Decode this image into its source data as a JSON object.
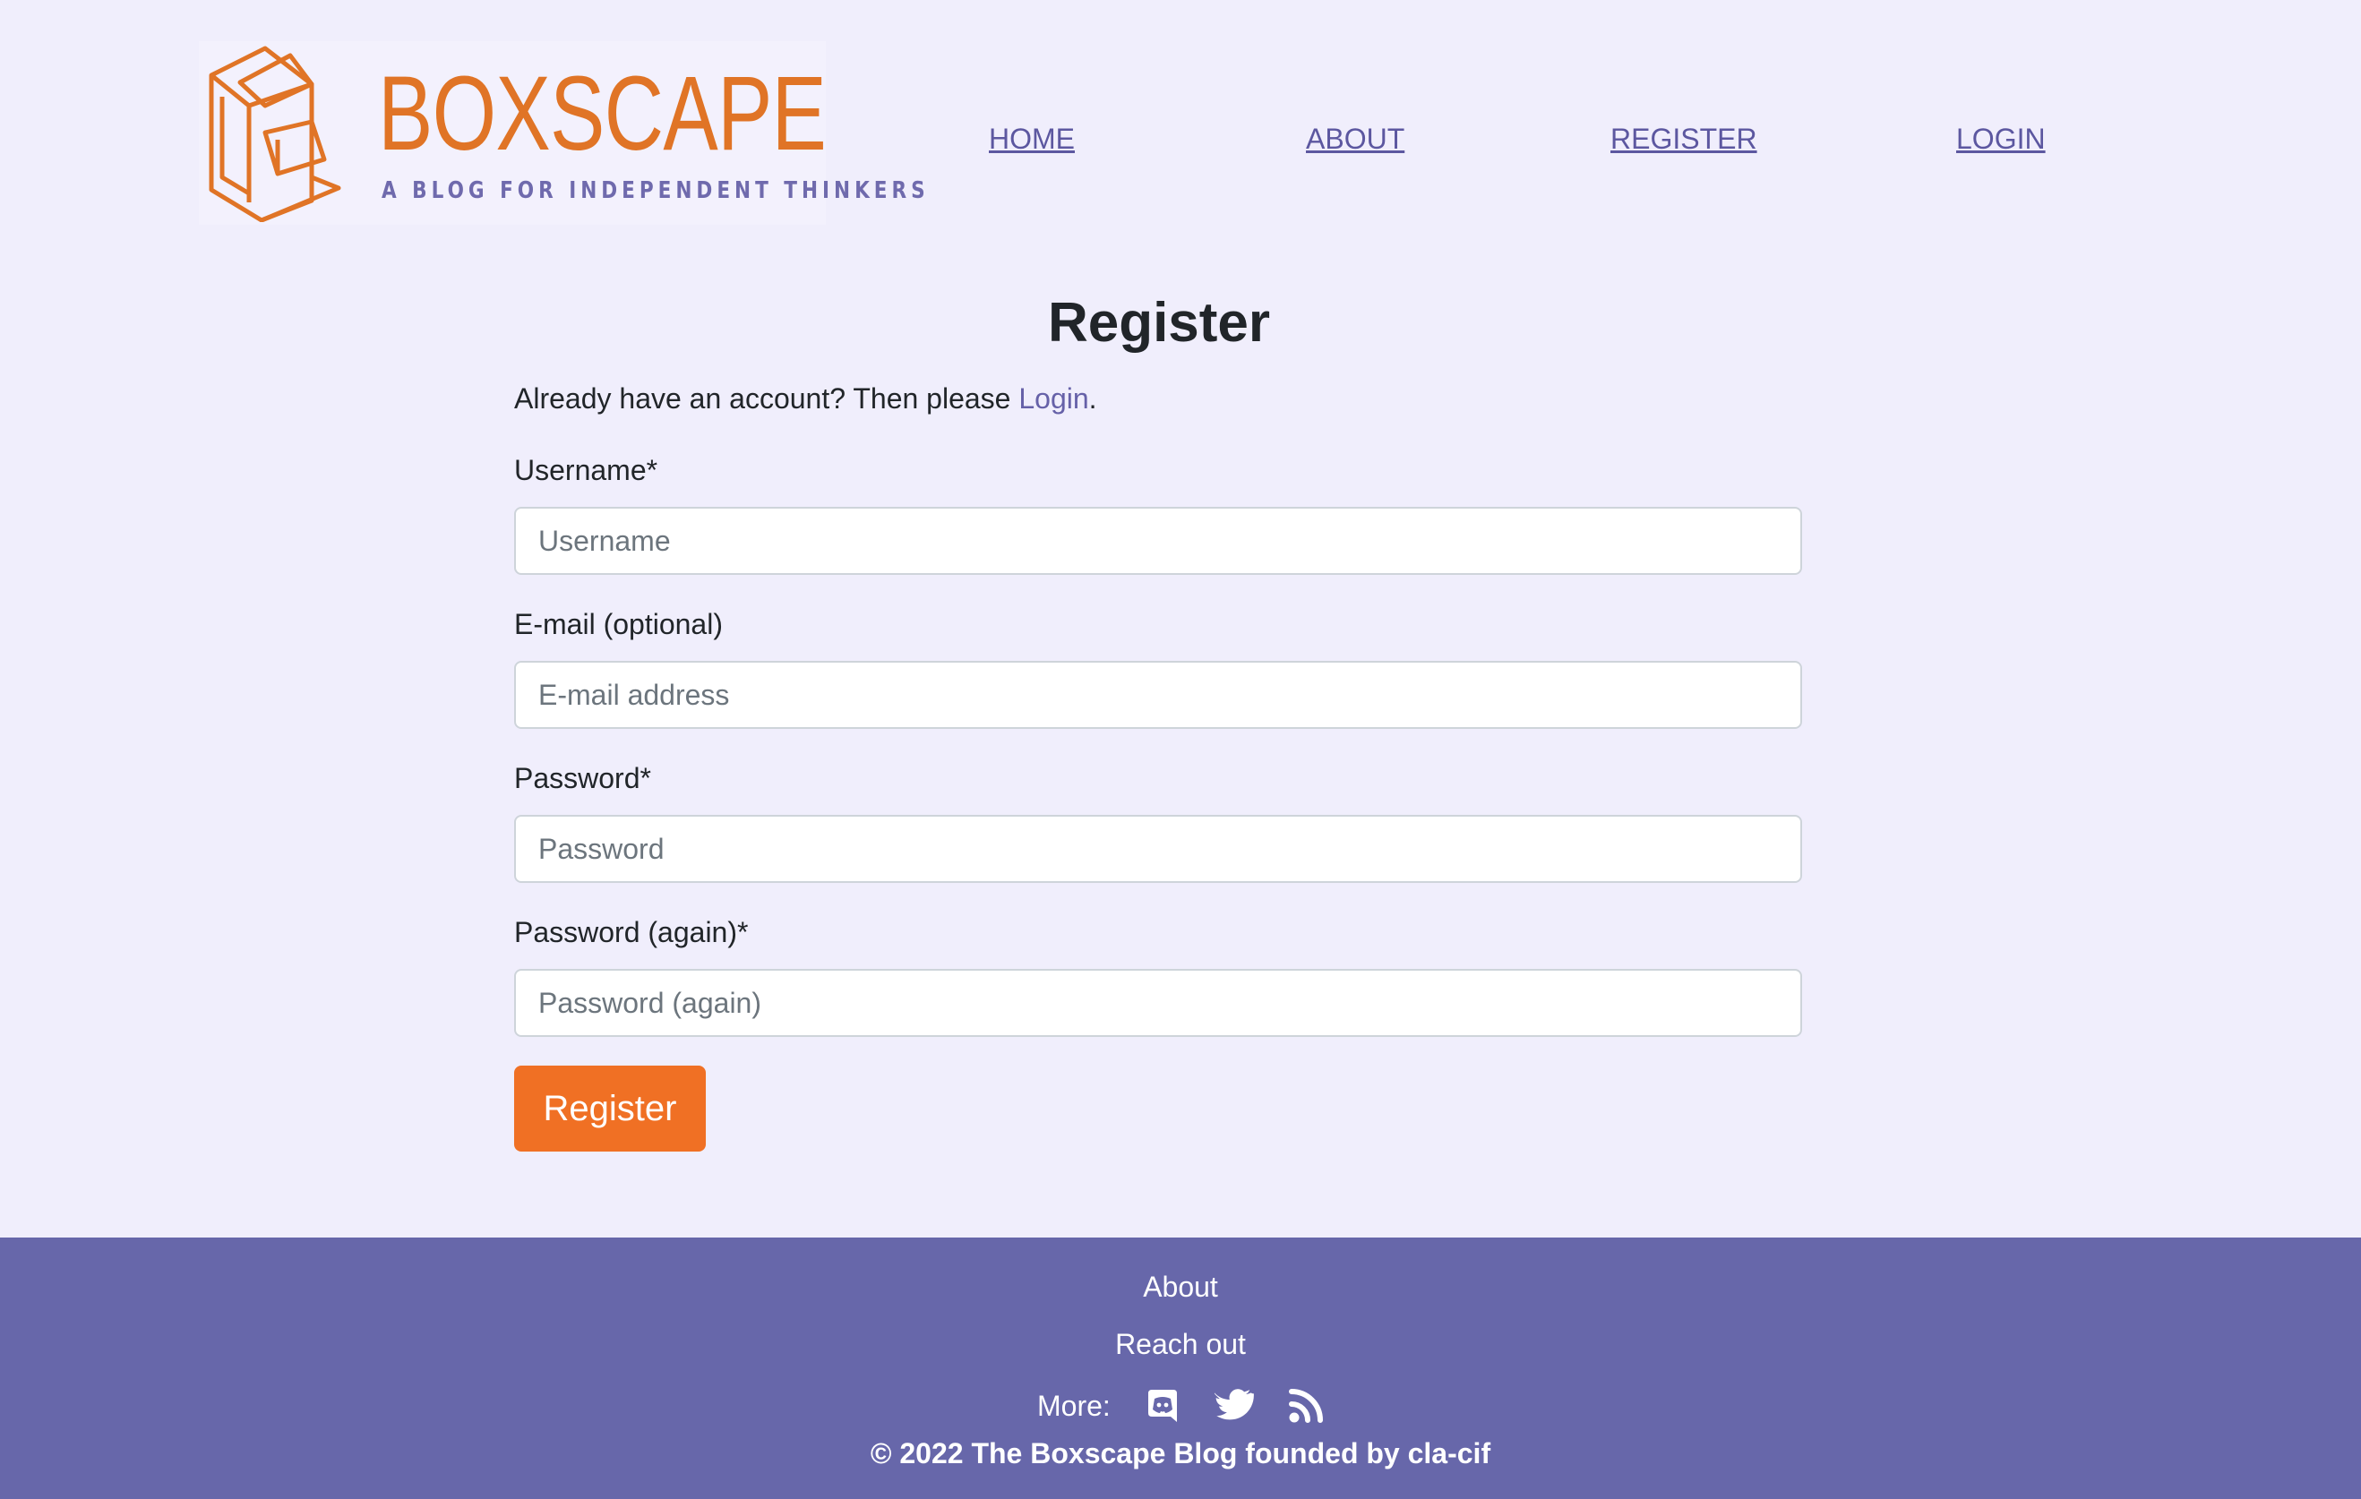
{
  "site": {
    "logo_title": "BOXSCAPE",
    "logo_tagline": "A BLOG FOR INDEPENDENT THINKERS",
    "brand_color": "#e07426",
    "accent_color": "#6767aa"
  },
  "nav": {
    "home": "HOME",
    "about": "ABOUT",
    "register": "REGISTER",
    "login": "LOGIN"
  },
  "form": {
    "title": "Register",
    "intro_text": "Already have an account? Then please ",
    "intro_link": "Login",
    "intro_end": ".",
    "fields": [
      {
        "label": "Username*",
        "placeholder": "Username",
        "value": ""
      },
      {
        "label": "E-mail (optional)",
        "placeholder": "E-mail address",
        "value": ""
      },
      {
        "label": "Password*",
        "placeholder": "Password",
        "value": ""
      },
      {
        "label": "Password (again)*",
        "placeholder": "Password (again)",
        "value": ""
      }
    ],
    "submit_label": "Register",
    "submit_color": "#f07024"
  },
  "footer": {
    "about": "About",
    "reach_out": "Reach out",
    "more_label": "More:",
    "social_icons": [
      "discord-icon",
      "twitter-icon",
      "rss-icon"
    ],
    "copyright": "© 2022 The Boxscape Blog founded by cla-cif"
  }
}
